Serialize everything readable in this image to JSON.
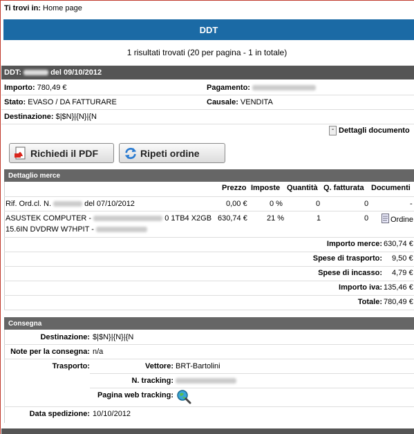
{
  "breadcrumb": {
    "label": "Ti trovi in:",
    "value": "Home page"
  },
  "page_title": "DDT",
  "results_info": "1 risultati trovati (20 per pagina - 1 in totale)",
  "ddt": {
    "prefix": "DDT:",
    "date_text": "del 09/10/2012",
    "importo_label": "Importo:",
    "importo_value": "780,49 €",
    "pagamento_label": "Pagamento:",
    "stato_label": "Stato:",
    "stato_value": "EVASO / DA FATTURARE",
    "causale_label": "Causale:",
    "causale_value": "VENDITA",
    "destinazione_label": "Destinazione:",
    "destinazione_value": "$|$N}|{N}|{N",
    "details_toggle": "-",
    "details_label": "Dettagli documento"
  },
  "buttons": {
    "pdf": "Richiedi il PDF",
    "repeat": "Ripeti ordine"
  },
  "dettaglio": {
    "title": "Dettaglio merce",
    "headers": [
      "Prezzo",
      "Imposte",
      "Quantità",
      "Q. fatturata",
      "Documenti"
    ],
    "rows": [
      {
        "desc1": "Rif. Ord.cl. N.",
        "desc1_tail": "del 07/10/2012",
        "prezzo": "0,00 €",
        "imposte": "0 %",
        "quantita": "0",
        "fatturata": "0",
        "doc": "-"
      },
      {
        "desc1": "ASUSTEK COMPUTER -",
        "desc1_tail": "0 1TB4 X2GB",
        "desc2": "15.6IN DVDRW W7HPIT -",
        "prezzo": "630,74 €",
        "imposte": "21 %",
        "quantita": "1",
        "fatturata": "0",
        "doc": "Ordine"
      }
    ],
    "totals": [
      {
        "label": "Importo merce:",
        "value": "630,74 €"
      },
      {
        "label": "Spese di trasporto:",
        "value": "9,50 €"
      },
      {
        "label": "Spese di incasso:",
        "value": "4,79 €"
      },
      {
        "label": "Importo iva:",
        "value": "135,46 €"
      },
      {
        "label": "Totale:",
        "value": "780,49 €"
      }
    ]
  },
  "consegna": {
    "title": "Consegna",
    "destinazione_label": "Destinazione:",
    "destinazione_value": "$|$N}|{N}|{N",
    "note_label": "Note per la consegna:",
    "note_value": "n/a",
    "trasporto_label": "Trasporto:",
    "vettore_label": "Vettore:",
    "vettore_value": "BRT-Bartolini",
    "tracking_label": "N. tracking:",
    "web_tracking_label": "Pagina web tracking:",
    "data_label": "Data spedizione:",
    "data_value": "10/10/2012"
  },
  "icons": {
    "pdf": "pdf-icon",
    "repeat": "refresh-icon",
    "doc": "document-icon",
    "tracking": "magnifier-globe-icon"
  },
  "colors": {
    "title_bar": "#1b6aa5",
    "section_header": "#666666",
    "ddt_header": "#555555"
  }
}
